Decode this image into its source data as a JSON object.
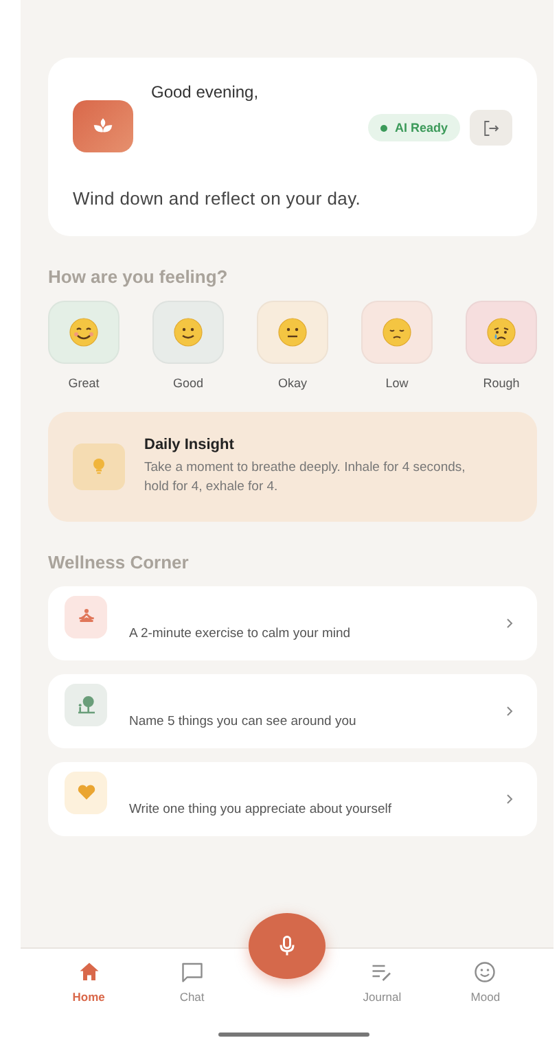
{
  "header": {
    "greeting": "Good evening,",
    "status_badge": "AI Ready",
    "subtitle": "Wind down and reflect on your day."
  },
  "mood_section": {
    "title": "How are you feeling?",
    "moods": [
      {
        "kind": "great",
        "label": "Great",
        "color": "#e4efe6"
      },
      {
        "kind": "good",
        "label": "Good",
        "color": "#e8ece9"
      },
      {
        "kind": "okay",
        "label": "Okay",
        "color": "#f8ecdc"
      },
      {
        "kind": "low",
        "label": "Low",
        "color": "#f8e6df"
      },
      {
        "kind": "rough",
        "label": "Rough",
        "color": "#f6dede"
      }
    ]
  },
  "insight": {
    "title": "Daily Insight",
    "text": "Take a moment to breathe deeply. Inhale for 4 seconds, hold for 4, exhale for 4."
  },
  "wellness": {
    "title": "Wellness Corner",
    "items": [
      {
        "kind": "meditation",
        "text": "A 2-minute exercise to calm your mind"
      },
      {
        "kind": "nature",
        "text": "Name 5 things you can see around you"
      },
      {
        "kind": "heart",
        "text": "Write one thing you appreciate about yourself"
      }
    ]
  },
  "nav": [
    {
      "kind": "home",
      "label": "Home",
      "selected": true
    },
    {
      "kind": "chat",
      "label": "Chat",
      "selected": false
    },
    {
      "kind": "journal",
      "label": "Journal",
      "selected": false
    },
    {
      "kind": "mood",
      "label": "Mood",
      "selected": false
    }
  ]
}
